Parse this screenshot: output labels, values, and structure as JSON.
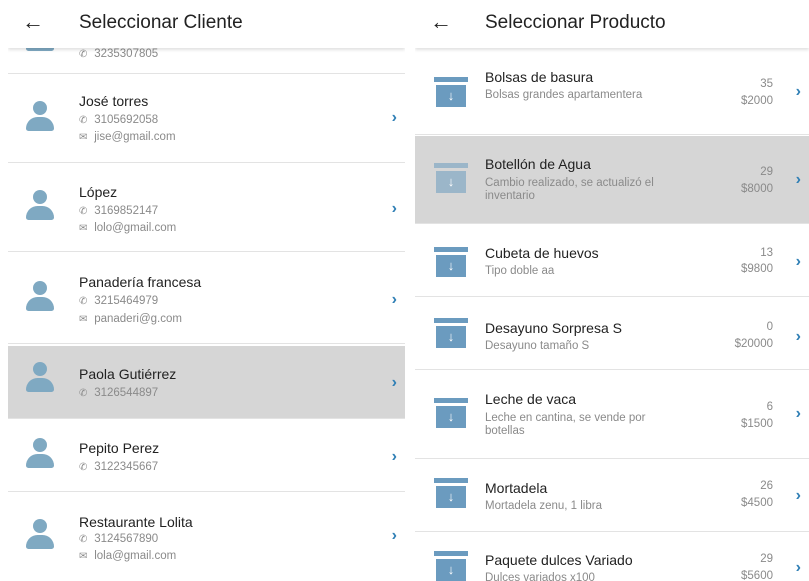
{
  "clientes": {
    "title": "Seleccionar Cliente",
    "back_icon": "←",
    "partial_top_phone": "3235307805",
    "items": [
      {
        "name": "José torres",
        "phone": "3105692058",
        "email": "jise@gmail.com"
      },
      {
        "name": "López",
        "phone": "3169852147",
        "email": "lolo@gmail.com"
      },
      {
        "name": "Panadería francesa",
        "phone": "3215464979",
        "email": "panaderi@g.com"
      },
      {
        "name": "Paola Gutiérrez",
        "phone": "3126544897",
        "email": ""
      },
      {
        "name": "Pepito Perez",
        "phone": "3122345667",
        "email": ""
      },
      {
        "name": "Restaurante Lolita",
        "phone": "3124567890",
        "email": "lola@gmail.com"
      }
    ]
  },
  "productos": {
    "title": "Seleccionar Producto",
    "back_icon": "←",
    "items": [
      {
        "name": "Bolsas de basura",
        "desc": "Bolsas grandes apartamentera",
        "stock": "35",
        "price": "$2000"
      },
      {
        "name": "Botellón de Agua",
        "desc": "Cambio realizado, se actualizó el inventario",
        "stock": "29",
        "price": "$8000"
      },
      {
        "name": "Cubeta de huevos",
        "desc": "Tipo doble aa",
        "stock": "13",
        "price": "$9800"
      },
      {
        "name": "Desayuno Sorpresa S",
        "desc": "Desayuno tamaño S",
        "stock": "0",
        "price": "$20000"
      },
      {
        "name": "Leche de vaca",
        "desc": "Leche en cantina, se vende por botellas",
        "stock": "6",
        "price": "$1500"
      },
      {
        "name": "Mortadela",
        "desc": "Mortadela zenu, 1 libra",
        "stock": "26",
        "price": "$4500"
      },
      {
        "name": "Paquete dulces Variado",
        "desc": "Dulces variados x100",
        "stock": "29",
        "price": "$5600"
      }
    ]
  },
  "icons": {
    "chevron": "›",
    "phone": "✆",
    "email": "✉",
    "download": "↓"
  },
  "colors": {
    "accent": "#2f7fb5",
    "icon_blue": "#7fa9c2",
    "selected_row": "#d6d6d6"
  }
}
